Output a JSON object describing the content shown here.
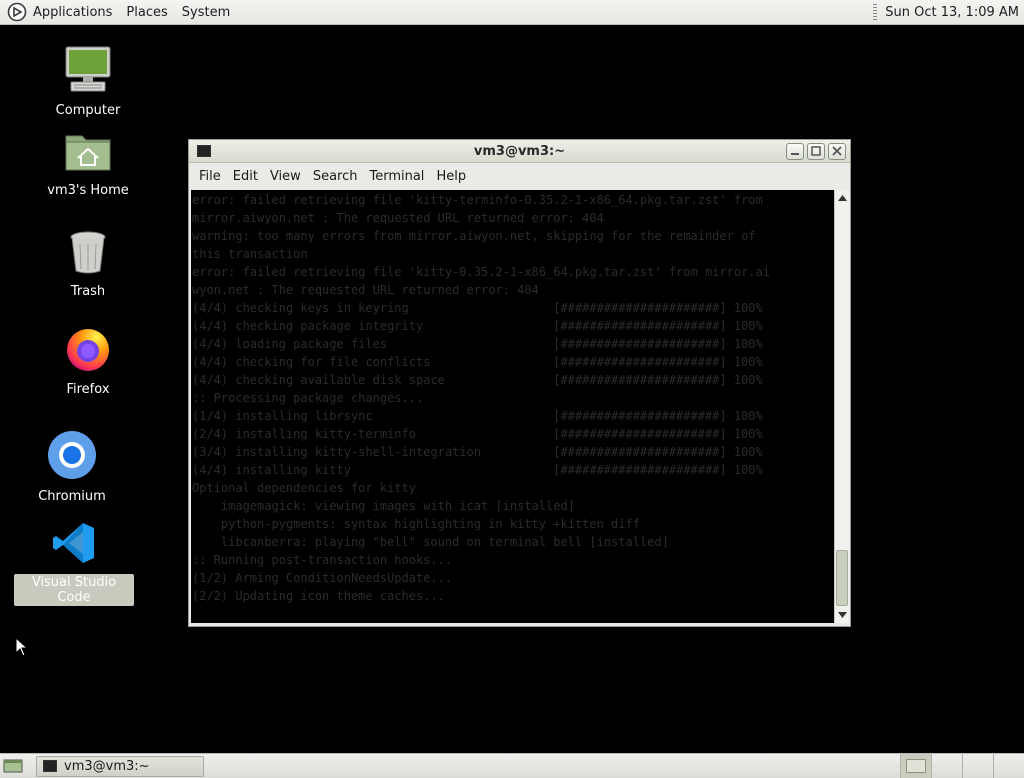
{
  "top_panel": {
    "menus": [
      "Applications",
      "Places",
      "System"
    ],
    "clock": "Sun Oct 13,  1:09 AM"
  },
  "desktop_icons": [
    {
      "label": "Computer",
      "icon": "computer-icon"
    },
    {
      "label": "vm3's Home",
      "icon": "home-folder-icon"
    },
    {
      "label": "Trash",
      "icon": "trash-icon"
    },
    {
      "label": "Firefox",
      "icon": "firefox-icon"
    },
    {
      "label": "Chromium",
      "icon": "chromium-icon"
    },
    {
      "label": "Visual Studio Code",
      "icon": "vscode-icon",
      "selected": true
    }
  ],
  "terminal": {
    "title": "vm3@vm3:~",
    "menus": [
      "File",
      "Edit",
      "View",
      "Search",
      "Terminal",
      "Help"
    ],
    "lines": [
      "error: failed retrieving file 'kitty-terminfo-0.35.2-1-x86_64.pkg.tar.zst' from",
      "mirror.aiwyon.net : The requested URL returned error: 404",
      "warning: too many errors from mirror.aiwyon.net, skipping for the remainder of",
      "this transaction",
      "error: failed retrieving file 'kitty-0.35.2-1-x86_64.pkg.tar.zst' from mirror.ai",
      "wyon.net : The requested URL returned error: 404",
      "(4/4) checking keys in keyring                    [######################] 100%",
      "(4/4) checking package integrity                  [######################] 100%",
      "(4/4) loading package files                       [######################] 100%",
      "(4/4) checking for file conflicts                 [######################] 100%",
      "(4/4) checking available disk space               [######################] 100%",
      ":: Processing package changes...",
      "(1/4) installing librsync                         [######################] 100%",
      "(2/4) installing kitty-terminfo                   [######################] 100%",
      "(3/4) installing kitty-shell-integration          [######################] 100%",
      "(4/4) installing kitty                            [######################] 100%",
      "Optional dependencies for kitty",
      "    imagemagick: viewing images with icat [installed]",
      "    python-pygments: syntax highlighting in kitty +kitten diff",
      "    libcanberra: playing \"bell\" sound on terminal bell [installed]",
      ":: Running post-transaction hooks...",
      "(1/2) Arming ConditionNeedsUpdate...",
      "(2/2) Updating icon theme caches..."
    ]
  },
  "taskbar": {
    "task_label": "vm3@vm3:~",
    "workspaces": 4
  }
}
